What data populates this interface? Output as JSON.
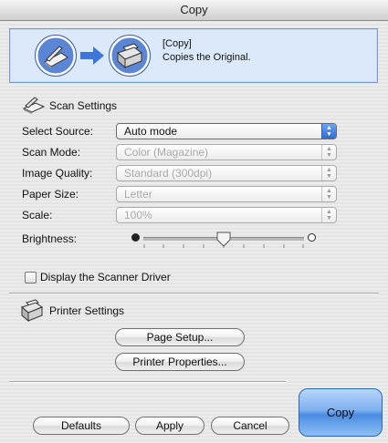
{
  "window": {
    "title": "Copy"
  },
  "banner": {
    "heading": "[Copy]",
    "description": "Copies the Original.",
    "icons": [
      "scanner-icon",
      "arrow-right-icon",
      "printer-icon"
    ]
  },
  "scan_settings": {
    "title": "Scan Settings",
    "icon": "scanner-icon",
    "fields": [
      {
        "label": "Select Source:",
        "value": "Auto mode",
        "enabled": true
      },
      {
        "label": "Scan Mode:",
        "value": "Color (Magazine)",
        "enabled": false
      },
      {
        "label": "Image Quality:",
        "value": "Standard (300dpi)",
        "enabled": false
      },
      {
        "label": "Paper Size:",
        "value": "Letter",
        "enabled": false
      },
      {
        "label": "Scale:",
        "value": "100%",
        "enabled": false
      }
    ],
    "brightness": {
      "label": "Brightness:",
      "position": 0.5
    }
  },
  "display_scanner_driver": {
    "label": "Display the Scanner Driver",
    "checked": false
  },
  "printer_settings": {
    "title": "Printer Settings",
    "icon": "printer-icon",
    "page_setup_label": "Page Setup...",
    "printer_properties_label": "Printer Properties..."
  },
  "footer": {
    "defaults_label": "Defaults",
    "apply_label": "Apply",
    "cancel_label": "Cancel",
    "copy_label": "Copy"
  },
  "colors": {
    "accent": "#4a8be3",
    "banner_bg": "#dbe9fb"
  }
}
